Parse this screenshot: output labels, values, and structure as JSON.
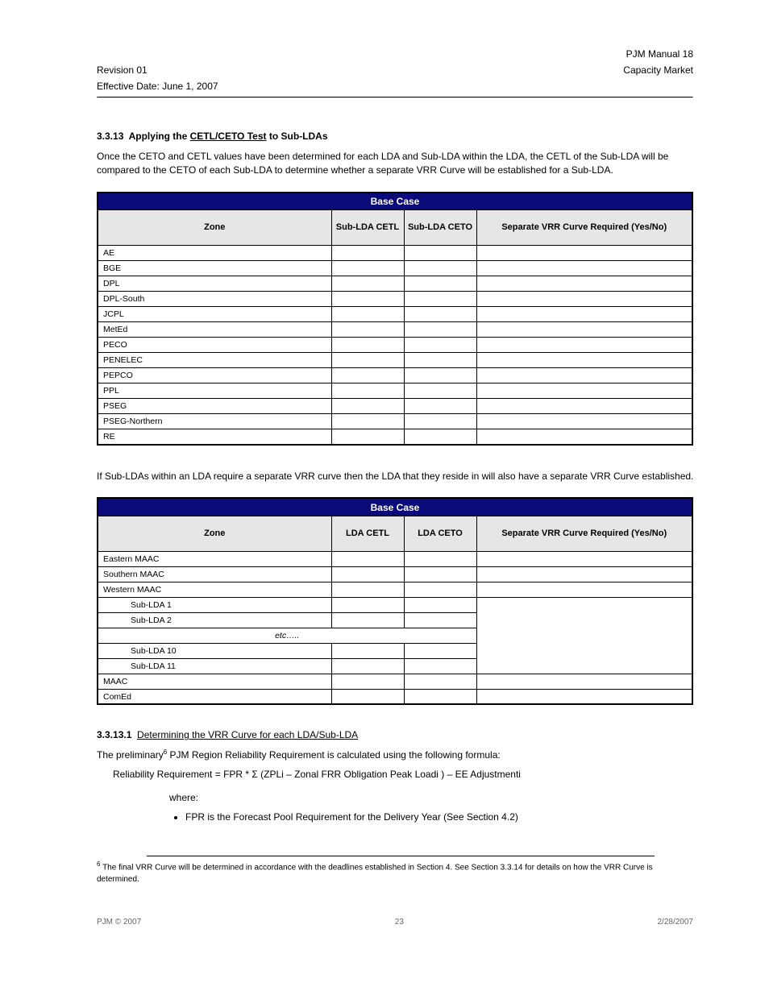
{
  "header": {
    "right_title": "PJM Manual 18",
    "left_subtitle": "Revision 01",
    "right_subtitle": "Capacity Market",
    "left_date": "Effective Date: June 1, 2007"
  },
  "section": {
    "number": "3.3.13",
    "title_pre": "Applying the ",
    "title_ul": "CETL/CETO Test",
    "title_post": " to Sub-LDAs"
  },
  "para1": "Once the CETO and CETL values have been determined for each LDA and Sub-LDA within the LDA, the CETL of the Sub-LDA will be compared to the CETO of each Sub-LDA to determine whether a separate VRR Curve will be established for a Sub-LDA.",
  "table1": {
    "title": "Base Case",
    "headers": [
      "Zone",
      "Sub-LDA CETL",
      "Sub-LDA CETO",
      "Separate VRR Curve Required (Yes/No)"
    ],
    "rows": [
      [
        "AE",
        "",
        "",
        ""
      ],
      [
        "BGE",
        "",
        "",
        ""
      ],
      [
        "DPL",
        "",
        "",
        ""
      ],
      [
        "DPL-South",
        "",
        "",
        ""
      ],
      [
        "JCPL",
        "",
        "",
        ""
      ],
      [
        "MetEd",
        "",
        "",
        ""
      ],
      [
        "PECO",
        "",
        "",
        ""
      ],
      [
        "PENELEC",
        "",
        "",
        ""
      ],
      [
        "PEPCO",
        "",
        "",
        ""
      ],
      [
        "PPL",
        "",
        "",
        ""
      ],
      [
        "PSEG",
        "",
        "",
        ""
      ],
      [
        "PSEG-Northern",
        "",
        "",
        ""
      ],
      [
        "RE",
        "",
        "",
        ""
      ]
    ]
  },
  "para2": "If Sub-LDAs within an LDA require a separate VRR curve then the LDA that they reside in will also have a separate VRR Curve established.",
  "table2": {
    "title": "Base Case",
    "headers": [
      "Zone",
      "LDA CETL",
      "LDA CETO",
      "Separate VRR Curve Required (Yes/No)"
    ],
    "rows_top": [
      [
        "Eastern MAAC",
        "",
        "",
        ""
      ],
      [
        "Southern MAAC",
        "",
        "",
        ""
      ],
      [
        "Western MAAC",
        "",
        "",
        ""
      ]
    ],
    "rows_sub": [
      [
        "Sub-LDA 1",
        "",
        ""
      ],
      [
        "Sub-LDA 2",
        "",
        ""
      ]
    ],
    "etc": "etc…..",
    "empty_cell": "",
    "rows_bottom": [
      [
        "Sub-LDA 10",
        "",
        ""
      ],
      [
        "Sub-LDA 11",
        "",
        ""
      ],
      [
        "MAAC",
        "",
        "",
        ""
      ],
      [
        "ComEd",
        "",
        "",
        ""
      ]
    ]
  },
  "sub_sec": {
    "num": "3.3.13.1",
    "label": "Determining the VRR Curve for each LDA/Sub-LDA"
  },
  "formula_intro_pre": "The preliminary",
  "formula_intro_post": " PJM Region Reliability Requirement is calculated using the following formula:",
  "sup6": "6",
  "formula": "Reliability Requirement = FPR * Σ (ZPLi – Zonal FRR Obligation Peak Loadi ) – EE Adjustmenti",
  "formula_where": "where:",
  "formula_bullet": "FPR is the Forecast Pool Requirement for the Delivery Year (See Section 4.2)",
  "footnote": "The final VRR Curve will be determined in accordance with the deadlines established in Section 4. See Section 3.3.14 for details on how the VRR Curve is determined.",
  "footer": {
    "left": "PJM © 2007",
    "center": "23",
    "right": "2/28/2007"
  }
}
